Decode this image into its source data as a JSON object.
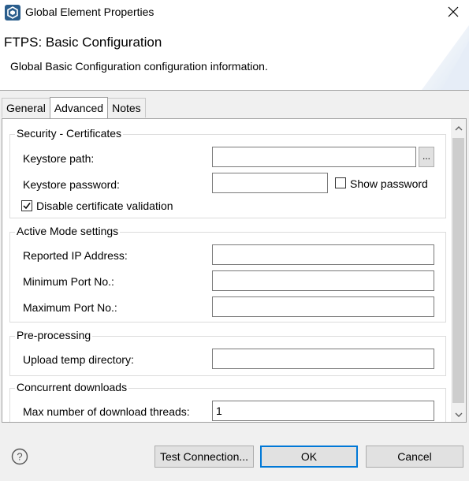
{
  "window": {
    "title": "Global Element Properties"
  },
  "banner": {
    "title": "FTPS: Basic Configuration",
    "description": "Global Basic Configuration configuration information."
  },
  "tabs": [
    {
      "label": "General",
      "active": false
    },
    {
      "label": "Advanced",
      "active": true
    },
    {
      "label": "Notes",
      "active": false
    }
  ],
  "security": {
    "title": "Security - Certificates",
    "keystore_path_label": "Keystore path:",
    "keystore_path_value": "",
    "browse_label": "...",
    "keystore_password_label": "Keystore password:",
    "keystore_password_value": "",
    "show_password_label": "Show password",
    "show_password_checked": false,
    "disable_validation_label": "Disable certificate validation",
    "disable_validation_checked": true
  },
  "active_mode": {
    "title": "Active Mode settings",
    "reported_ip_label": "Reported IP Address:",
    "reported_ip_value": "",
    "min_port_label": "Minimum Port No.:",
    "min_port_value": "",
    "max_port_label": "Maximum Port No.:",
    "max_port_value": ""
  },
  "preprocessing": {
    "title": "Pre-processing",
    "upload_temp_label": "Upload temp directory:",
    "upload_temp_value": ""
  },
  "concurrent": {
    "title": "Concurrent downloads",
    "max_threads_label": "Max number of download threads:",
    "max_threads_value": "1"
  },
  "buttons": {
    "test_connection": "Test Connection...",
    "ok": "OK",
    "cancel": "Cancel"
  },
  "colors": {
    "accent": "#0078d7",
    "app_icon": "#2a5d8c"
  },
  "icons": {
    "app": "app-logo-icon",
    "close": "close-icon",
    "help": "help-icon",
    "scroll_up": "chevron-up-icon",
    "scroll_down": "chevron-down-icon"
  }
}
